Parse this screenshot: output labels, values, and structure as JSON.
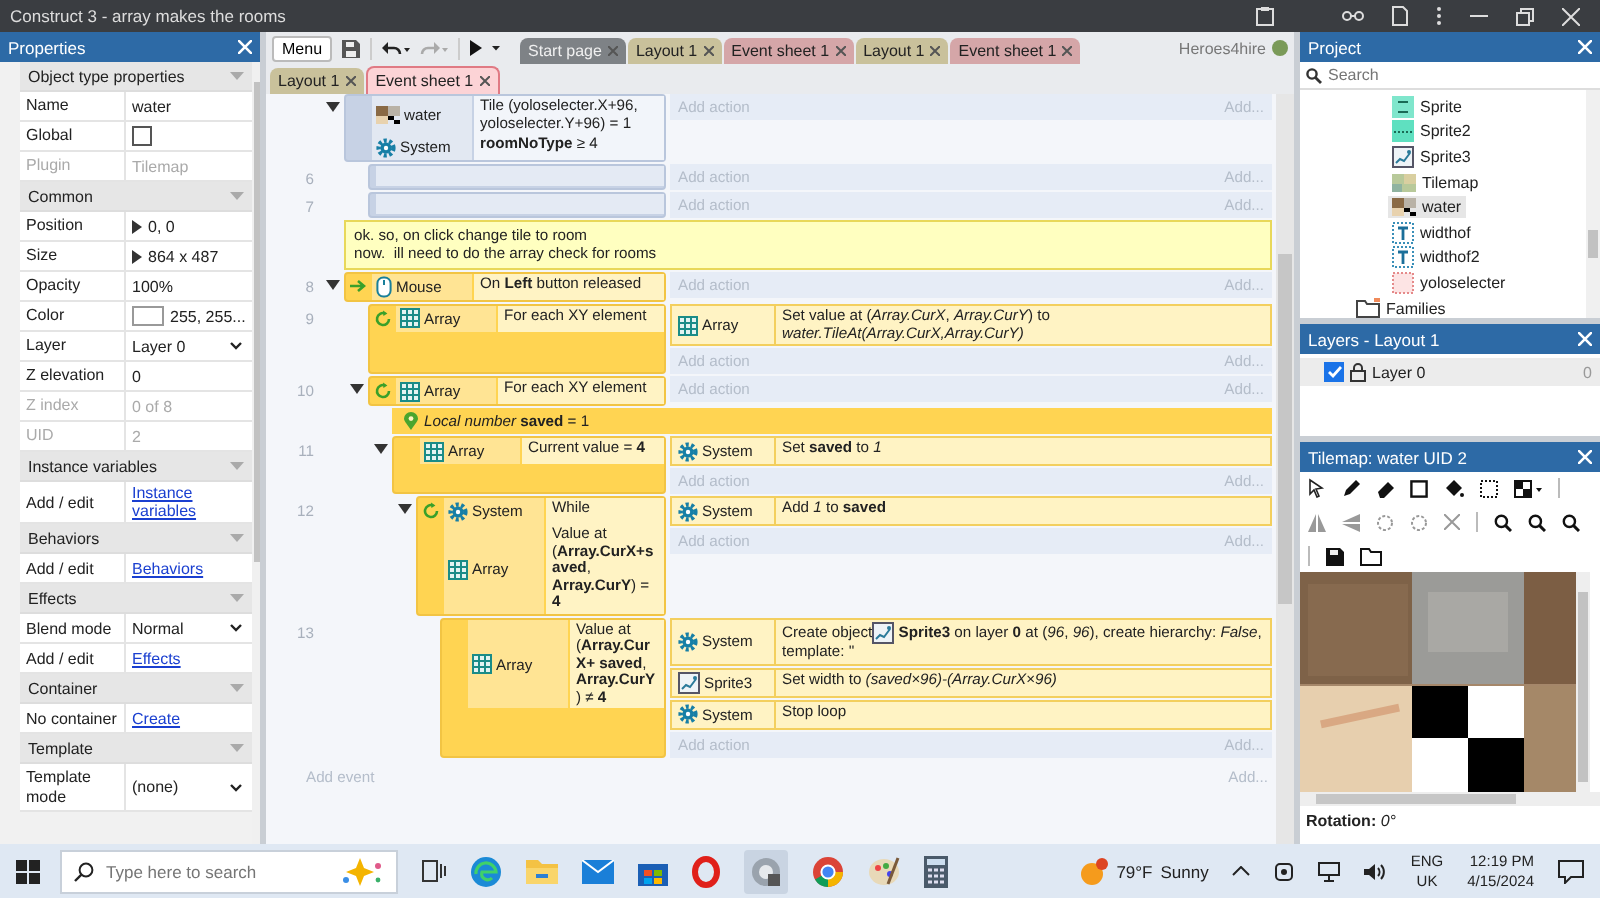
{
  "window": {
    "title": "Construct 3 - array makes the rooms"
  },
  "properties": {
    "title": "Properties",
    "sections": [
      {
        "title": "Object type properties",
        "rows": [
          {
            "label": "Name",
            "value": "water",
            "kind": "text",
            "disabled": false
          },
          {
            "label": "Global",
            "kind": "checkbox",
            "checked": false,
            "disabled": false
          },
          {
            "label": "Plugin",
            "value": "Tilemap",
            "kind": "text",
            "disabled": true
          }
        ]
      },
      {
        "title": "Common",
        "rows": [
          {
            "label": "Position",
            "value": "0, 0",
            "kind": "expander",
            "disabled": false
          },
          {
            "label": "Size",
            "value": "864 x 487",
            "kind": "expander",
            "disabled": false
          },
          {
            "label": "Opacity",
            "value": "100%",
            "kind": "text",
            "disabled": false
          },
          {
            "label": "Color",
            "value": "255, 255...",
            "kind": "color",
            "disabled": false
          },
          {
            "label": "Layer",
            "value": "Layer 0",
            "kind": "dropdown",
            "disabled": false
          },
          {
            "label": "Z elevation",
            "value": "0",
            "kind": "text",
            "disabled": false
          },
          {
            "label": "Z index",
            "value": "0 of 8",
            "kind": "text",
            "disabled": true
          },
          {
            "label": "UID",
            "value": "2",
            "kind": "text",
            "disabled": true
          }
        ]
      },
      {
        "title": "Instance variables",
        "rows": [
          {
            "label": "Add / edit",
            "value": "Instance variables",
            "kind": "link",
            "disabled": false
          }
        ]
      },
      {
        "title": "Behaviors",
        "rows": [
          {
            "label": "Add / edit",
            "value": "Behaviors",
            "kind": "link",
            "disabled": false
          }
        ]
      },
      {
        "title": "Effects",
        "rows": [
          {
            "label": "Blend mode",
            "value": "Normal",
            "kind": "dropdown",
            "disabled": false
          },
          {
            "label": "Add / edit",
            "value": "Effects",
            "kind": "link",
            "disabled": false
          }
        ]
      },
      {
        "title": "Container",
        "rows": [
          {
            "label": "No container",
            "value": "Create",
            "kind": "link",
            "disabled": false
          }
        ]
      },
      {
        "title": "Template",
        "rows": [
          {
            "label": "Template mode",
            "value": "(none)",
            "kind": "dropdown",
            "disabled": false
          }
        ]
      }
    ]
  },
  "toolbar": {
    "menu": "Menu",
    "user": "Heroes4hire"
  },
  "top_tabs": [
    {
      "label": "Start page",
      "kind": "start",
      "selected": false
    },
    {
      "label": "Layout 1",
      "kind": "layout",
      "selected": false
    },
    {
      "label": "Event sheet 1",
      "kind": "events",
      "selected": false
    },
    {
      "label": "Layout 1",
      "kind": "layout",
      "selected": false
    },
    {
      "label": "Event sheet 1",
      "kind": "events",
      "selected": false
    }
  ],
  "tabs": [
    {
      "label": "Layout 1",
      "kind": "layout",
      "selected": false
    },
    {
      "label": "Event sheet 1",
      "kind": "events",
      "selected": true
    }
  ],
  "event_sheet": {
    "items": [
      {
        "kind": "event",
        "selected": false,
        "expanded": true,
        "conditions": [
          {
            "object": "water",
            "kind": "tilemap",
            "text": "Tile (yoloselecter.X+96, yoloselecter.Y+96) = 1"
          },
          {
            "object": "System",
            "kind": "system",
            "text": "**roomNoType** ≥ 4"
          }
        ],
        "add_action": "Add action",
        "add_hint": "Add...",
        "children": [
          {
            "kind": "event",
            "number": "6",
            "selected": false,
            "add_action": "Add action",
            "add_hint": "Add..."
          },
          {
            "kind": "event",
            "number": "7",
            "selected": false,
            "add_action": "Add action",
            "add_hint": "Add..."
          }
        ]
      },
      {
        "kind": "comment",
        "text": "ok. so, on click change tile to room\nnow.  ill need to do the array check for rooms"
      },
      {
        "kind": "event",
        "number": "8",
        "selected": true,
        "expanded": true,
        "conditions": [
          {
            "object": "Mouse",
            "kind": "trigger-mouse",
            "text": "On **Left** button released"
          }
        ],
        "add_action": "Add action",
        "add_hint": "Add...",
        "children": [
          {
            "kind": "event",
            "number": "9",
            "selected": true,
            "conditions": [
              {
                "object": "Array",
                "kind": "loop-array",
                "text": "For each XY element"
              }
            ],
            "actions": [
              {
                "object": "Array",
                "kind": "array",
                "text": "Set value at (*Array.CurX*, *Array.CurY*) to *water.TileAt(Array.CurX,Array.CurY)*"
              }
            ],
            "add_action": "Add action",
            "add_hint": "Add..."
          },
          {
            "kind": "event",
            "number": "10",
            "selected": true,
            "expanded": true,
            "conditions": [
              {
                "object": "Array",
                "kind": "loop-array",
                "text": "For each XY element"
              }
            ],
            "add_action": "Add action",
            "add_hint": "Add...",
            "children": [
              {
                "kind": "variable",
                "text": "*Local number* **saved** = 1"
              },
              {
                "kind": "event",
                "number": "11",
                "selected": true,
                "expanded": true,
                "conditions": [
                  {
                    "object": "Array",
                    "kind": "array",
                    "text": "Current value = **4**"
                  }
                ],
                "actions": [
                  {
                    "object": "System",
                    "kind": "system",
                    "text": "Set **saved** to *1*"
                  }
                ],
                "add_action": "Add action",
                "add_hint": "Add...",
                "children": [
                  {
                    "kind": "event",
                    "number": "12",
                    "selected": true,
                    "expanded": true,
                    "conditions": [
                      {
                        "object": "System",
                        "kind": "loop-system",
                        "text": "While"
                      },
                      {
                        "object": "Array",
                        "kind": "array",
                        "text": "Value at (**Array.CurX+saved**, **Array.CurY**) = **4**"
                      }
                    ],
                    "actions": [
                      {
                        "object": "System",
                        "kind": "system",
                        "text": "Add *1* to **saved**"
                      }
                    ],
                    "add_action": "Add action",
                    "add_hint": "Add...",
                    "children": [
                      {
                        "kind": "event",
                        "number": "13",
                        "selected": true,
                        "conditions": [
                          {
                            "object": "Array",
                            "kind": "array",
                            "text": "Value at (**Array.CurX+ saved**, **Array.CurY**) ≠ **4**"
                          }
                        ],
                        "actions": [
                          {
                            "object": "System",
                            "kind": "system",
                            "text": "Create object",
                            "text_after": "**Sprite3** on layer **0** at (*96*, *96*), create hierarchy: *False*, template: ''"
                          },
                          {
                            "object": "Sprite3",
                            "kind": "sprite",
                            "text": "Set width to *(saved×96)-(Array.CurX×96)*"
                          },
                          {
                            "object": "System",
                            "kind": "system",
                            "text": "Stop loop"
                          }
                        ],
                        "add_action": "Add action",
                        "add_hint": "Add..."
                      }
                    ]
                  }
                ]
              }
            ]
          }
        ]
      }
    ],
    "add_event": "Add event",
    "add_event_hint": "Add..."
  },
  "project": {
    "title": "Project",
    "search": {
      "placeholder": "Search"
    },
    "tree": [
      {
        "children": [
          {
            "label": "Sprite",
            "kind": "tile",
            "selected": false
          },
          {
            "label": "Sprite2",
            "kind": "sprite-green",
            "selected": false
          },
          {
            "label": "Sprite3",
            "kind": "sprite",
            "selected": false
          },
          {
            "label": "Tilemap",
            "kind": "tilemap-light",
            "selected": false
          },
          {
            "label": "water",
            "kind": "tilemap",
            "selected": true
          },
          {
            "label": "widthof",
            "kind": "text",
            "selected": false
          },
          {
            "label": "widthof2",
            "kind": "text",
            "selected": false
          },
          {
            "label": "yoloselecter",
            "kind": "dotted",
            "selected": false
          }
        ]
      },
      {
        "label": "Families",
        "kind": "folder",
        "selected": false
      }
    ]
  },
  "layers": {
    "title": "Layers - Layout 1",
    "items": [
      {
        "name": "Layer 0",
        "visible": true,
        "count": "0"
      }
    ]
  },
  "tilemap": {
    "title": "Tilemap: water UID 2",
    "rotation_label": "Rotation:",
    "rotation": "0°"
  },
  "taskbar": {
    "search_placeholder": "Type here to search",
    "temperature": "79°F",
    "weather": "Sunny",
    "language": "ENG",
    "region": "UK",
    "time": "12:19 PM",
    "date": "4/15/2024"
  }
}
